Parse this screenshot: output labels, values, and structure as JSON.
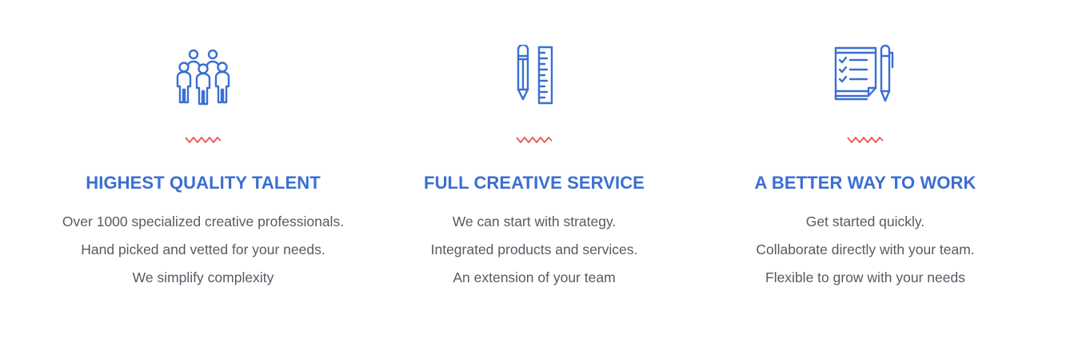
{
  "colors": {
    "accent": "#3a6fd1",
    "divider": "#e8585a",
    "body_text": "#555b63",
    "background": "#ffffff"
  },
  "features": [
    {
      "icon": "team-people-icon",
      "title": "HIGHEST QUALITY TALENT",
      "lines": [
        "Over 1000 specialized creative professionals.",
        "Hand picked and vetted for your needs.",
        "We simplify complexity"
      ]
    },
    {
      "icon": "pencil-ruler-icon",
      "title": "FULL CREATIVE SERVICE",
      "lines": [
        "We can start with strategy.",
        "Integrated products and services.",
        "An extension of your team"
      ]
    },
    {
      "icon": "checklist-pen-icon",
      "title": "A BETTER WAY TO WORK",
      "lines": [
        "Get started quickly.",
        "Collaborate directly with your team.",
        "Flexible to grow with your needs"
      ]
    }
  ]
}
